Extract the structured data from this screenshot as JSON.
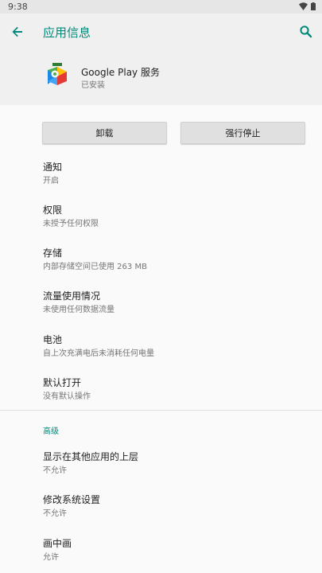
{
  "status_bar": {
    "time": "9:38",
    "icons": [
      "wifi-icon",
      "battery-icon"
    ]
  },
  "app_bar": {
    "title": "应用信息",
    "back_icon": "arrow-back-icon",
    "search_icon": "search-icon"
  },
  "app_header": {
    "name": "Google Play 服务",
    "status": "已安装",
    "icon": "google-play-services-icon"
  },
  "buttons": {
    "uninstall": "卸载",
    "force_stop": "强行停止"
  },
  "settings": [
    {
      "title": "通知",
      "subtitle": "开启"
    },
    {
      "title": "权限",
      "subtitle": "未授予任何权限"
    },
    {
      "title": "存储",
      "subtitle": "内部存储空间已使用 263 MB"
    },
    {
      "title": "流量使用情况",
      "subtitle": "未使用任何数据流量"
    },
    {
      "title": "电池",
      "subtitle": "自上次充满电后未消耗任何电量"
    },
    {
      "title": "默认打开",
      "subtitle": "没有默认操作"
    }
  ],
  "advanced": {
    "label": "高级",
    "items": [
      {
        "title": "显示在其他应用的上层",
        "subtitle": "不允许"
      },
      {
        "title": "修改系统设置",
        "subtitle": "不允许"
      },
      {
        "title": "画中画",
        "subtitle": "允许"
      }
    ]
  },
  "colors": {
    "accent": "#00897b",
    "background": "#fafafa",
    "header_background": "#f0f0f0"
  }
}
